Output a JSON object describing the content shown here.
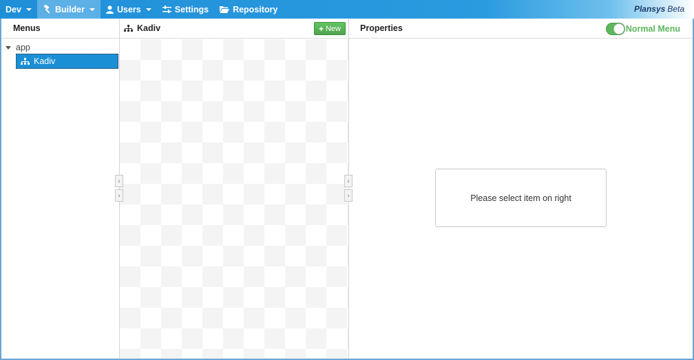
{
  "navbar": {
    "items": [
      {
        "label": "Dev",
        "has_caret": true
      },
      {
        "label": "Builder",
        "has_caret": true,
        "active": true
      },
      {
        "label": "Users",
        "has_caret": true
      },
      {
        "label": "Settings"
      },
      {
        "label": "Repository"
      }
    ],
    "brand": "Plansys",
    "brand_suffix": "Beta"
  },
  "menus_panel": {
    "title": "Menus",
    "tree": {
      "root": "app",
      "selected_item": "Kadiv"
    }
  },
  "center_panel": {
    "title": "Kadiv",
    "new_button": "New"
  },
  "properties_panel": {
    "title": "Properties",
    "toggle_label": "Normal Menu",
    "toggle_on": true,
    "placeholder": "Please select item on right"
  },
  "colors": {
    "navbar": "#2b9be0",
    "selected": "#1b8fd6",
    "success": "#5cb85c",
    "brand_text": "#1a3a6b"
  }
}
